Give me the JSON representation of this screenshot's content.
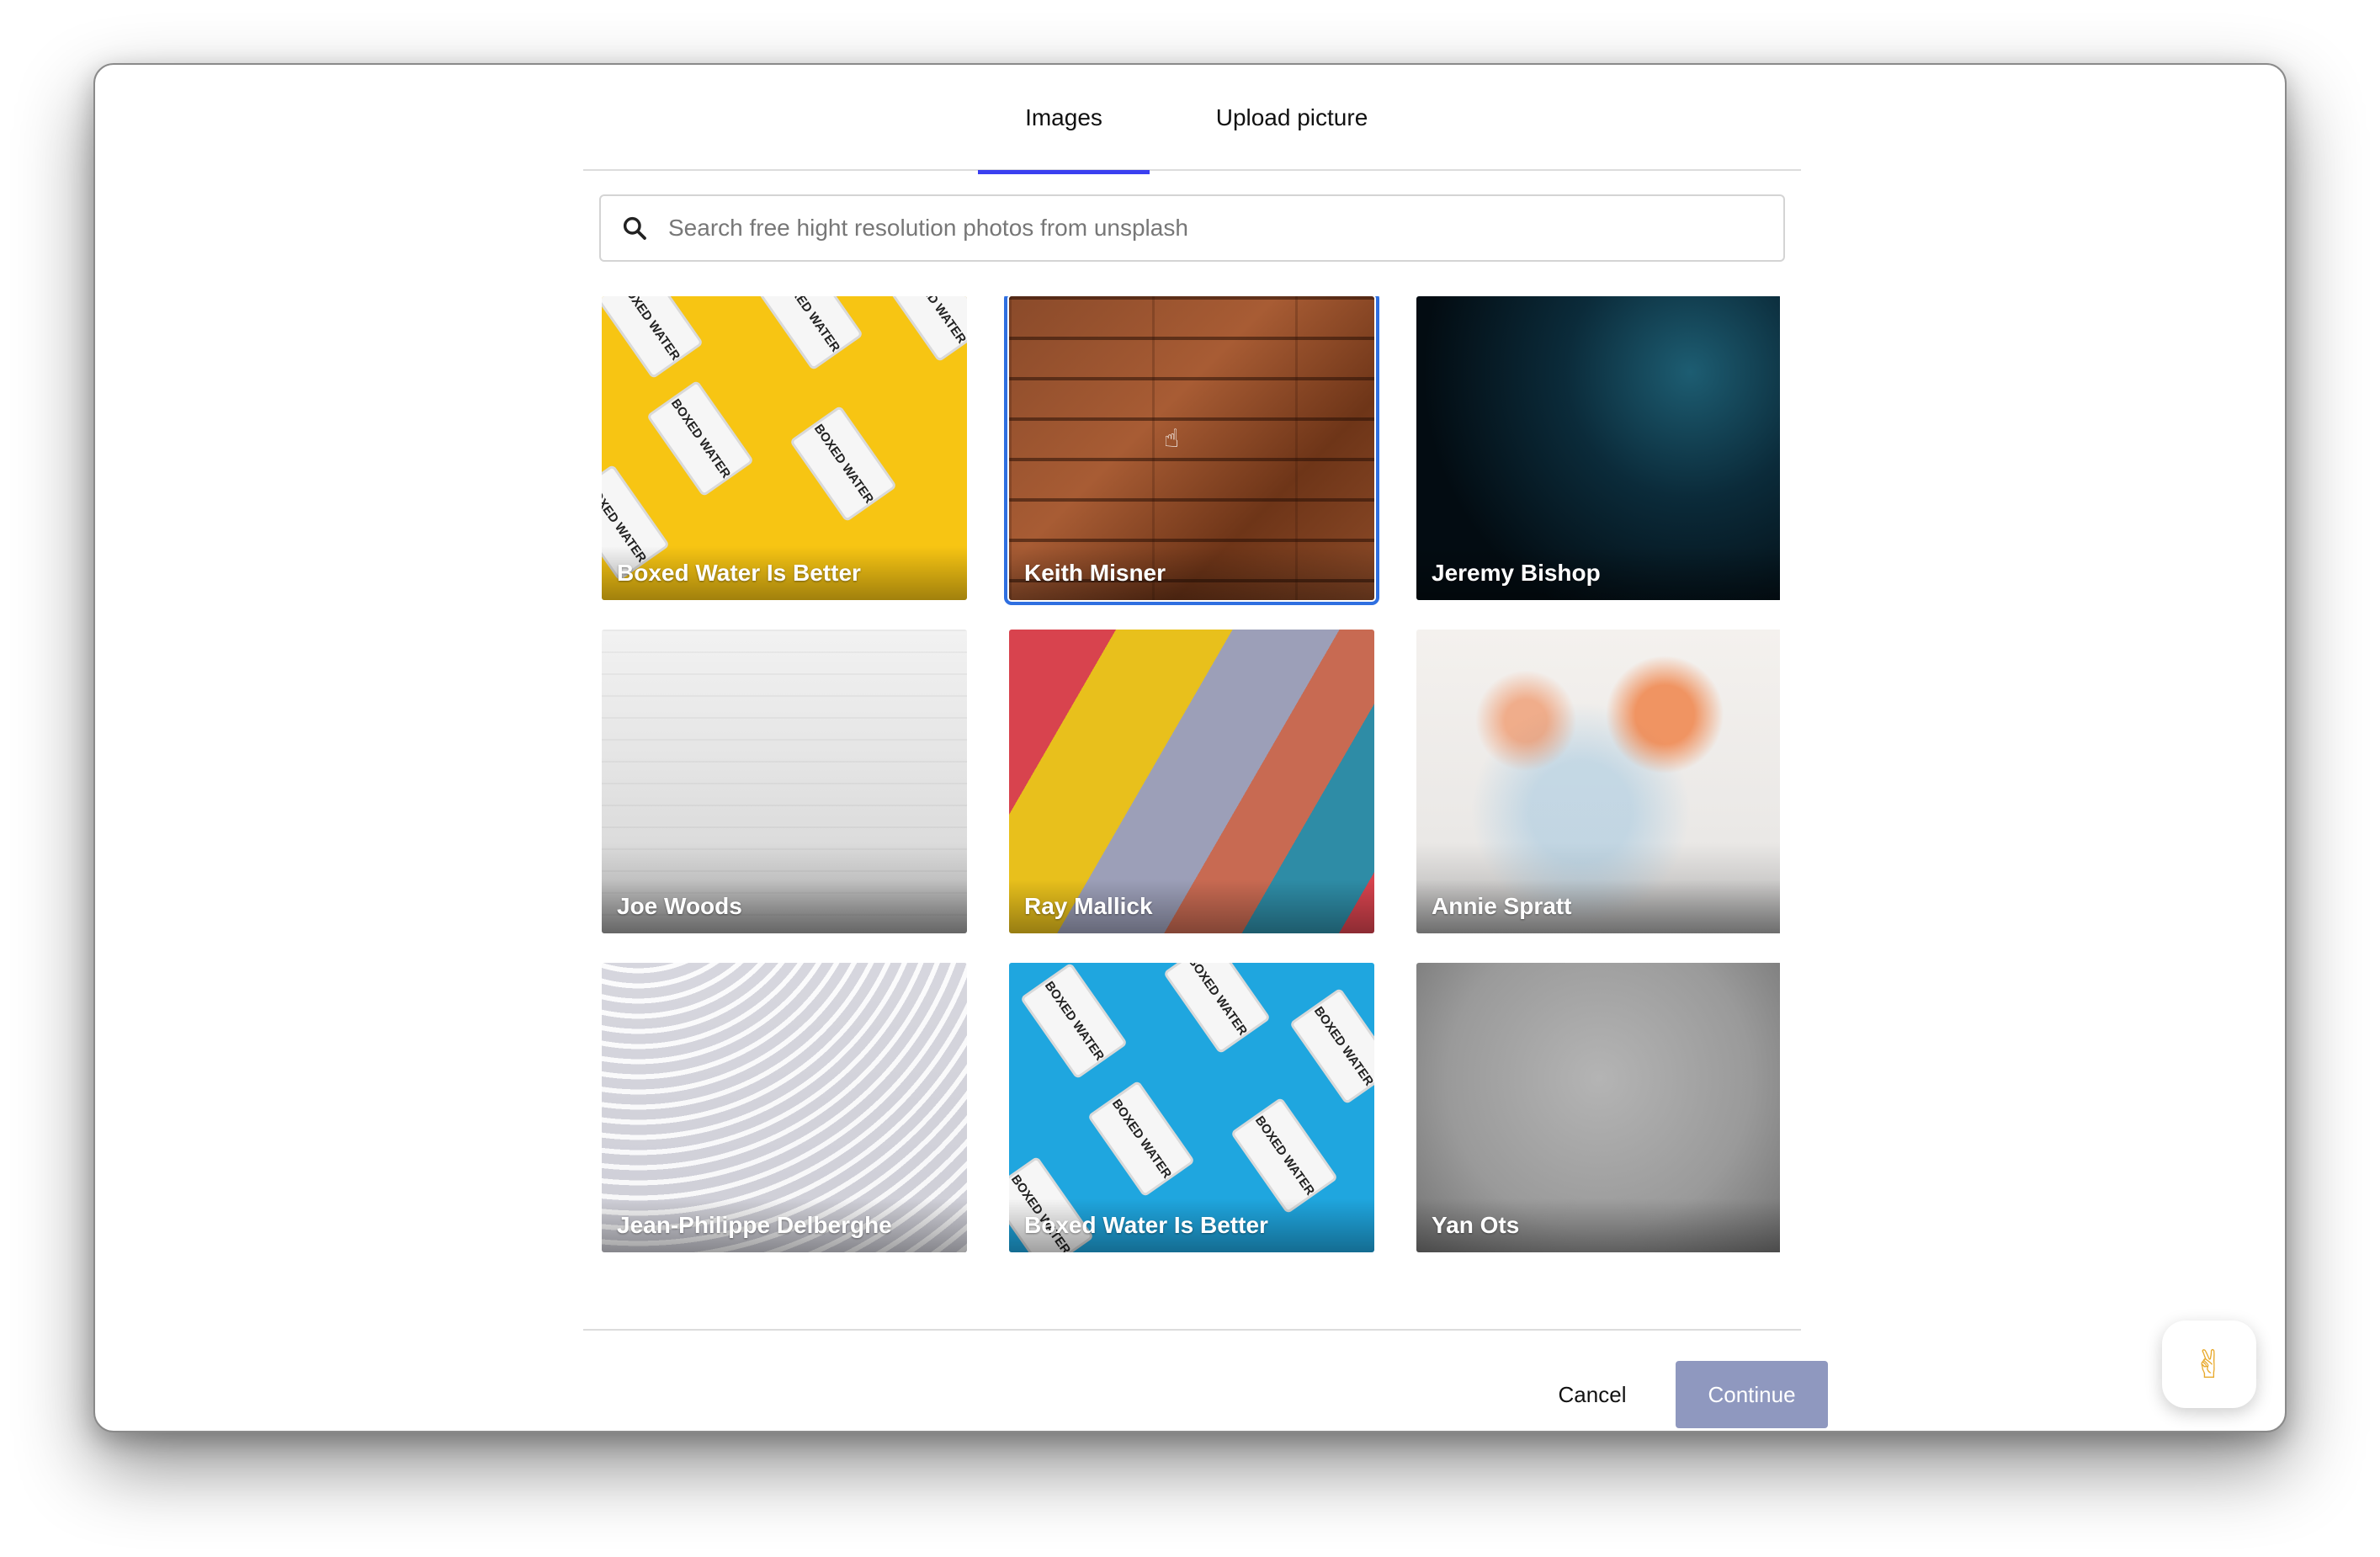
{
  "tabs": [
    {
      "label": "Images",
      "active": true
    },
    {
      "label": "Upload picture",
      "active": false
    }
  ],
  "search": {
    "placeholder": "Search free hight resolution photos from unsplash",
    "value": ""
  },
  "images": [
    {
      "author": "Boxed Water Is Better",
      "selected": false
    },
    {
      "author": "Keith Misner",
      "selected": true
    },
    {
      "author": "Jeremy Bishop",
      "selected": false
    },
    {
      "author": "Joe Woods",
      "selected": false
    },
    {
      "author": "Ray Mallick",
      "selected": false
    },
    {
      "author": "Annie Spratt",
      "selected": false
    },
    {
      "author": "Jean-Philippe Delberghe",
      "selected": false
    },
    {
      "author": "Boxed Water Is Better",
      "selected": false
    },
    {
      "author": "Yan Ots",
      "selected": false
    }
  ],
  "carton_text": "BOXED WATER",
  "footer": {
    "cancel_label": "Cancel",
    "continue_label": "Continue"
  },
  "fab": {
    "glyph": "✌"
  },
  "colors": {
    "accent": "#3a3ff0",
    "selection": "#2f6fe0",
    "continue_disabled": "#8f98bf"
  },
  "icons": {
    "search": "search-icon",
    "cursor": "hand-pointer-icon",
    "fab": "victory-hand-icon"
  }
}
